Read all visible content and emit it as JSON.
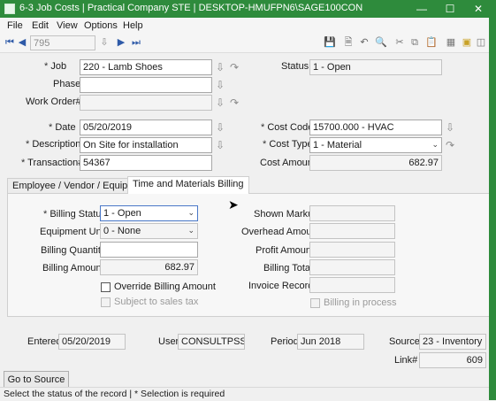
{
  "window": {
    "title": "6-3 Job Costs | Practical Company STE | DESKTOP-HMUFPN6\\SAGE100CON",
    "minimize": "—",
    "maximize": "☐",
    "close": "✕"
  },
  "menu": [
    "File",
    "Edit",
    "View",
    "Options",
    "Help"
  ],
  "nav": {
    "record_value": "795"
  },
  "form": {
    "job_label": "Job",
    "job_value": "220 - Lamb Shoes",
    "phase_label": "Phase",
    "phase_value": "",
    "work_order_label": "Work Order#",
    "work_order_value": "",
    "status_label": "Status",
    "status_value": "1 - Open",
    "date_label": "Date",
    "date_value": "05/20/2019",
    "description_label": "Description",
    "description_value": "On Site for installation",
    "transaction_label": "Transaction#",
    "transaction_value": "54367",
    "cost_code_label": "Cost Code",
    "cost_code_value": "15700.000 - HVAC",
    "cost_type_label": "Cost Type",
    "cost_type_value": "1 - Material",
    "cost_amount_label": "Cost Amount",
    "cost_amount_value": "682.97",
    "required_mark": "*"
  },
  "tabs": {
    "employee": "Employee / Vendor / Equipment",
    "tm_billing": "Time and Materials Billing"
  },
  "billing": {
    "billing_status_label": "Billing Status",
    "billing_status_value": "1 - Open",
    "equipment_unit_label": "Equipment Unit",
    "equipment_unit_value": "0 - None",
    "billing_quantity_label": "Billing Quantity",
    "billing_quantity_value": "",
    "billing_amount_label": "Billing Amount",
    "billing_amount_value": "682.97",
    "override_label": "Override Billing Amount",
    "subject_tax_label": "Subject to sales tax",
    "shown_markup_label": "Shown Markup",
    "overhead_amount_label": "Overhead Amount",
    "profit_amount_label": "Profit Amount",
    "billing_total_label": "Billing Total",
    "invoice_record_label": "Invoice Record#",
    "billing_in_process_label": "Billing in process"
  },
  "footer": {
    "entered_label": "Entered",
    "entered_value": "05/20/2019",
    "user_label": "User",
    "user_value": "CONSULTPSS\\tlam",
    "period_label": "Period",
    "period_value": "Jun 2018",
    "source_label": "Source",
    "source_value": "23 - Inventory",
    "link_label": "Link#",
    "link_value": "609",
    "go_to_source": "Go to Source"
  },
  "status_bar": "Select the status of the record  |  * Selection is required",
  "colors": {
    "titlebar": "#2e8b3c",
    "focus": "#4a78c8"
  }
}
